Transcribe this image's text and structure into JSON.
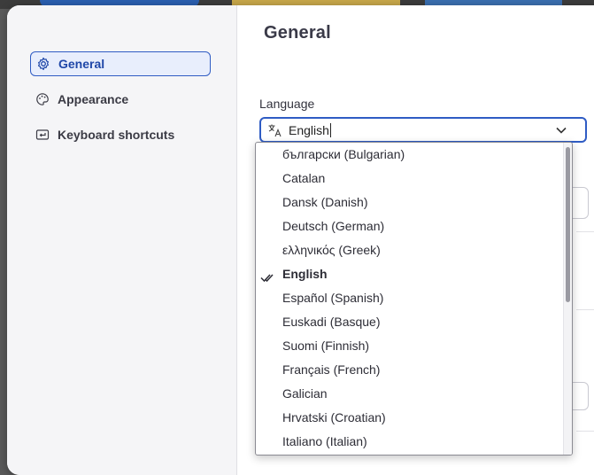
{
  "sidebar": {
    "items": [
      {
        "label": "General",
        "icon": "gear-icon",
        "active": true
      },
      {
        "label": "Appearance",
        "icon": "palette-icon",
        "active": false
      },
      {
        "label": "Keyboard shortcuts",
        "icon": "keyboard-return-icon",
        "active": false
      }
    ]
  },
  "main": {
    "title": "General",
    "language": {
      "label": "Language",
      "value": "English",
      "options": [
        "български (Bulgarian)",
        "Catalan",
        "Dansk (Danish)",
        "Deutsch (German)",
        "ελληνικός (Greek)",
        "English",
        "Español (Spanish)",
        "Euskadi (Basque)",
        "Suomi (Finnish)",
        "Français (French)",
        "Galician",
        "Hrvatski (Croatian)",
        "Italiano (Italian)"
      ],
      "selected_option": "English"
    }
  },
  "colors": {
    "accent": "#2f5cc4",
    "active_bg": "#e8eefc",
    "sidebar_bg": "#f5f5f7"
  }
}
